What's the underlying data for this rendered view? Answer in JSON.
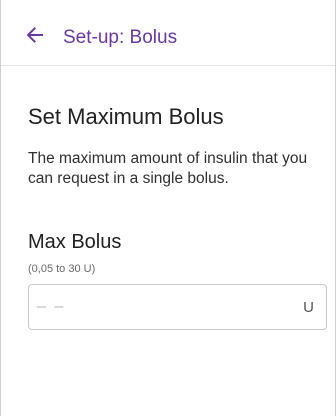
{
  "header": {
    "title": "Set-up: Bolus",
    "back_icon": "arrow-left-icon",
    "accent_color": "#6a38a3"
  },
  "section": {
    "title": "Set Maximum Bolus",
    "description": "The maximum amount of insulin that you can request in a single bolus."
  },
  "field": {
    "label": "Max Bolus",
    "range_hint": "(0,05 to 30 U)",
    "value": "",
    "placeholder": "– –",
    "unit": "U"
  }
}
